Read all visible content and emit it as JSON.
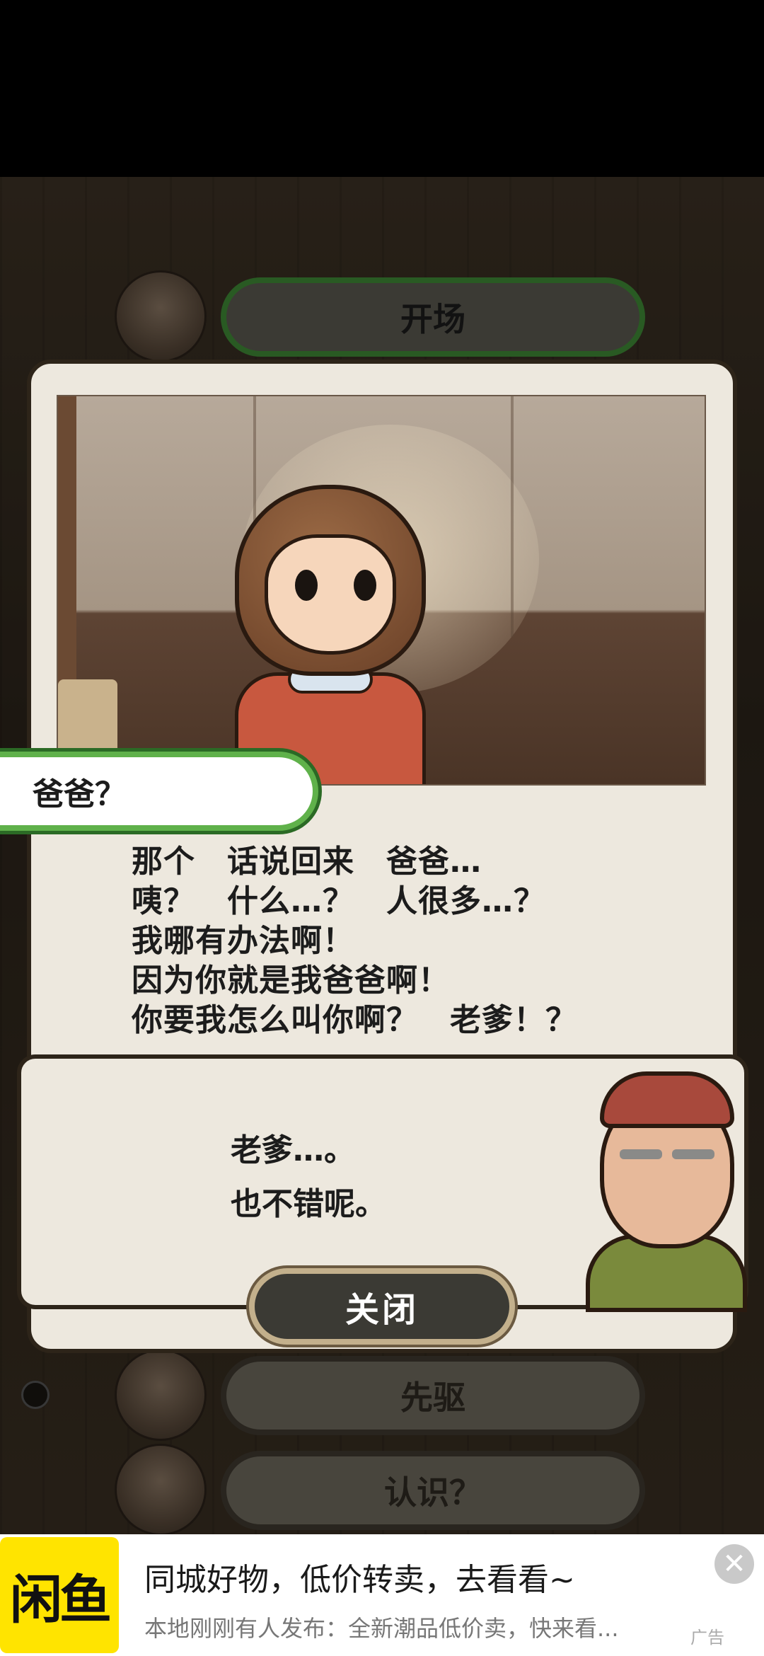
{
  "episode_list": {
    "rows": [
      {
        "label": "开场"
      },
      {
        "label": "先驱"
      },
      {
        "label": "认识？"
      }
    ]
  },
  "modal": {
    "speaker": "爸爸？",
    "story_lines": [
      "那个　话说回来　爸爸…",
      "咦？　什么…？　人很多…？",
      "我哪有办法啊！",
      "因为你就是我爸爸啊！",
      "你要我怎么叫你啊？　老爹！？"
    ],
    "reply_lines": [
      "老爹…。",
      "也不错呢。"
    ],
    "close_label": "关闭"
  },
  "ad": {
    "logo_text": "闲鱼",
    "title": "同城好物，低价转卖，去看看~",
    "subtitle": "本地刚刚有人发布：全新潮品低价卖，快来看...",
    "tag": "广告",
    "close_glyph": "✕",
    "brand_color": "#ffe400"
  },
  "colors": {
    "accent_green": "#5fb14a",
    "panel": "#ede8de",
    "close_button": "#3b3a34"
  }
}
